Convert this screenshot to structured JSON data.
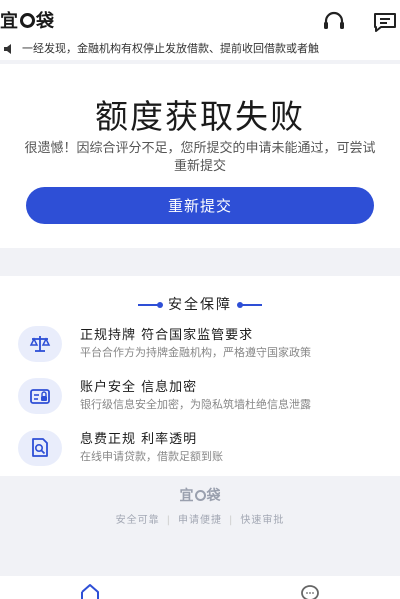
{
  "header": {
    "logo_left": "宜",
    "logo_right": "袋",
    "support_icon": "headset-icon",
    "message_icon": "message-icon"
  },
  "notice": {
    "icon": "speaker-icon",
    "text": "一经发现，金融机构有权停止发放借款、提前收回借款或者触"
  },
  "result": {
    "title": "额度获取失败",
    "message": "很遗憾！因综合评分不足，您所提交的申请未能通过，可尝试重新提交",
    "button_label": "重新提交"
  },
  "security": {
    "heading": "安全保障",
    "features": [
      {
        "icon": "scale-icon",
        "title": "正规持牌 符合国家监管要求",
        "desc": "平台合作方为持牌金融机构，严格遵守国家政策"
      },
      {
        "icon": "lock-card-icon",
        "title": "账户安全 信息加密",
        "desc": "银行级信息安全加密，为隐私筑墙杜绝信息泄露"
      },
      {
        "icon": "document-search-icon",
        "title": "息费正规  利率透明",
        "desc": "在线申请贷款，借款足额到账"
      }
    ]
  },
  "footer": {
    "brand_left": "宜",
    "brand_right": "袋",
    "tags": [
      "安全可靠",
      "申请便捷",
      "快速审批"
    ]
  },
  "tabbar": {
    "items": [
      {
        "icon": "home-icon"
      },
      {
        "icon": "chat-icon"
      }
    ]
  },
  "colors": {
    "accent": "#2e4fd6",
    "icon_bg": "#e9edfb",
    "page_bg": "#f1f2f6"
  }
}
